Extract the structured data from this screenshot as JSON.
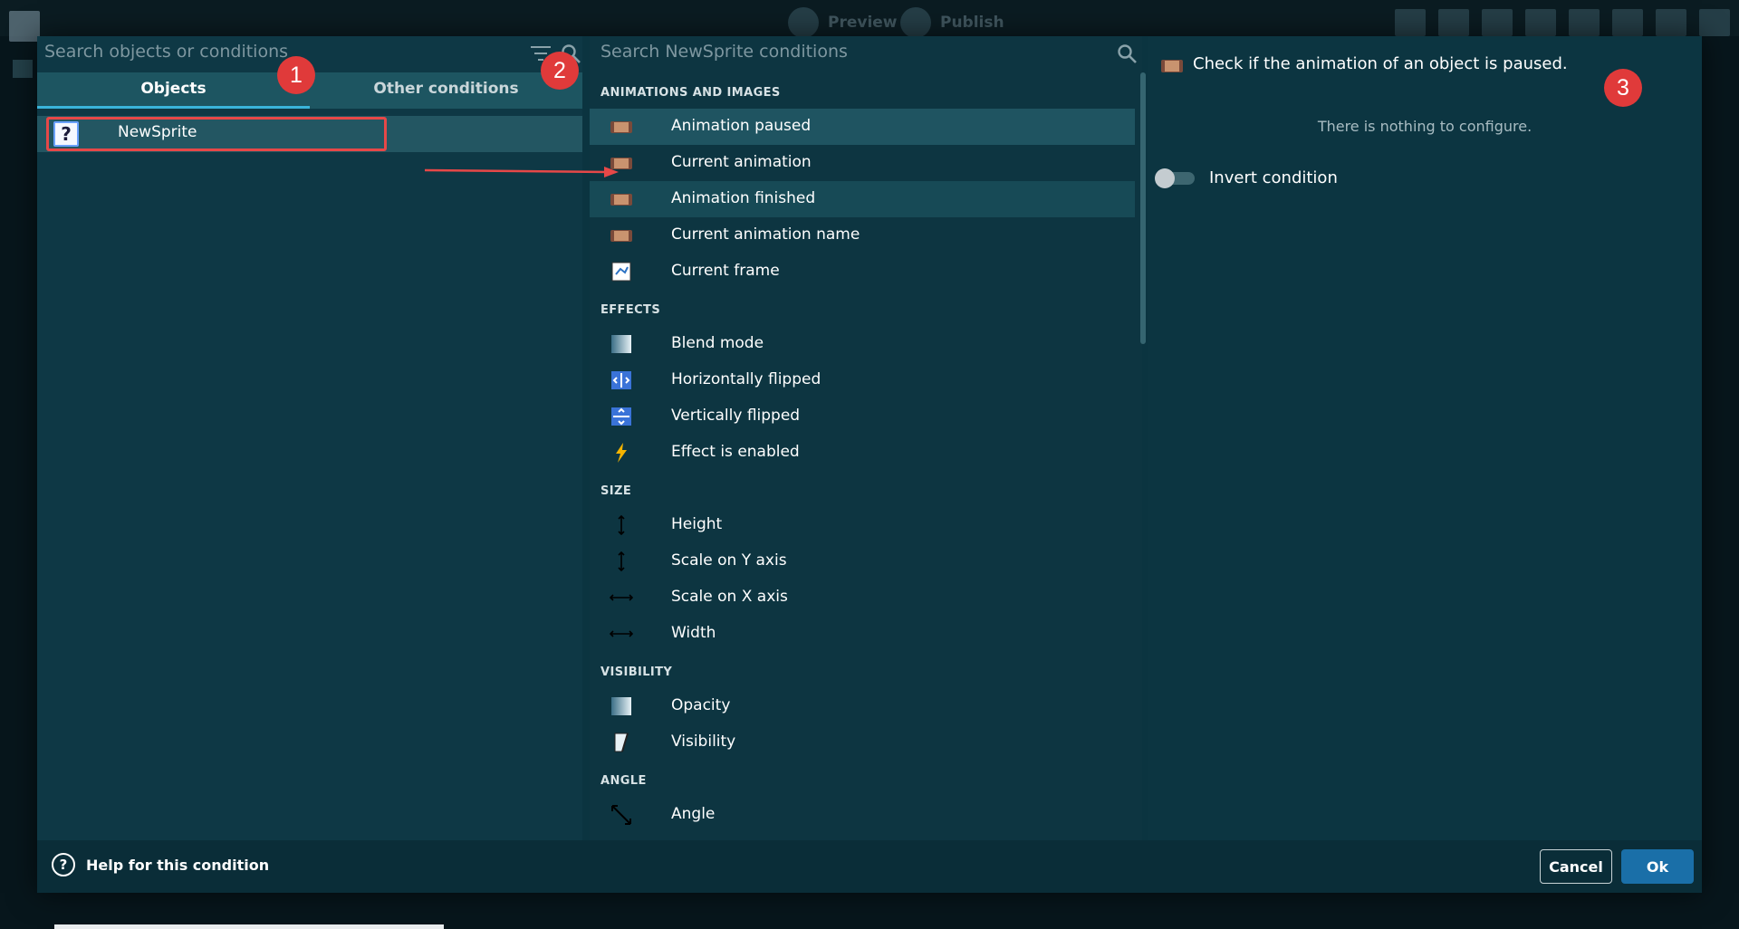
{
  "toolbar": {
    "preview_label": "Preview",
    "publish_label": "Publish"
  },
  "dialog": {
    "search_objects_placeholder": "Search objects or conditions",
    "tabs": [
      {
        "label": "Objects",
        "active": true
      },
      {
        "label": "Other conditions",
        "active": false
      }
    ],
    "objects": [
      {
        "label": "NewSprite",
        "icon": "question-mark-sprite-icon"
      }
    ],
    "search_conditions_placeholder": "Search NewSprite conditions",
    "sections": [
      {
        "title": "ANIMATIONS AND IMAGES",
        "items": [
          {
            "label": "Animation paused",
            "icon": "film-icon",
            "state": "selected"
          },
          {
            "label": "Current animation",
            "icon": "film-icon"
          },
          {
            "label": "Animation finished",
            "icon": "film-icon",
            "state": "hover"
          },
          {
            "label": "Current animation name",
            "icon": "film-icon"
          },
          {
            "label": "Current frame",
            "icon": "frame-icon"
          }
        ]
      },
      {
        "title": "EFFECTS",
        "items": [
          {
            "label": "Blend mode",
            "icon": "blend-icon"
          },
          {
            "label": "Horizontally flipped",
            "icon": "flip-horizontal-icon"
          },
          {
            "label": "Vertically flipped",
            "icon": "flip-vertical-icon"
          },
          {
            "label": "Effect is enabled",
            "icon": "lightning-icon"
          }
        ]
      },
      {
        "title": "SIZE",
        "items": [
          {
            "label": "Height",
            "icon": "vertical-arrows-icon"
          },
          {
            "label": "Scale on Y axis",
            "icon": "vertical-arrows-icon"
          },
          {
            "label": "Scale on X axis",
            "icon": "horizontal-arrows-icon"
          },
          {
            "label": "Width",
            "icon": "horizontal-arrows-icon"
          }
        ]
      },
      {
        "title": "VISIBILITY",
        "items": [
          {
            "label": "Opacity",
            "icon": "opacity-icon"
          },
          {
            "label": "Visibility",
            "icon": "visibility-icon"
          }
        ]
      },
      {
        "title": "ANGLE",
        "items": [
          {
            "label": "Angle",
            "icon": "angle-icon"
          }
        ]
      }
    ],
    "description": "Check if the animation of an object is paused.",
    "nothing_to_configure": "There is nothing to configure.",
    "invert_label": "Invert condition",
    "invert_value": false,
    "help_label": "Help for this condition",
    "cancel_label": "Cancel",
    "ok_label": "Ok"
  },
  "annotations": {
    "badge1": "1",
    "badge2": "2",
    "badge3": "3"
  },
  "colors": {
    "accent": "#1a6fa8",
    "highlight": "#e64848",
    "badge": "#e03a3a"
  }
}
